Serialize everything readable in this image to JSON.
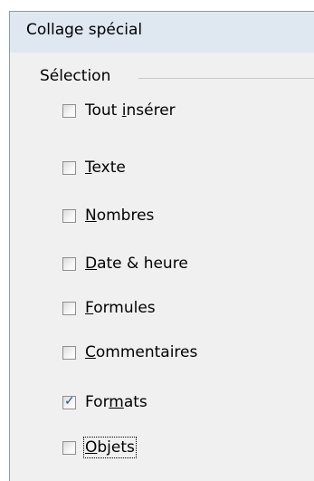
{
  "dialog": {
    "title": "Collage spécial"
  },
  "selection": {
    "label": "Sélection",
    "options": [
      {
        "pre": "Tout ",
        "ul": "i",
        "post": "nsérer",
        "checked": false
      },
      {
        "pre": "",
        "ul": "T",
        "post": "exte",
        "checked": false
      },
      {
        "pre": "",
        "ul": "N",
        "post": "ombres",
        "checked": false
      },
      {
        "pre": "",
        "ul": "D",
        "post": "ate & heure",
        "checked": false
      },
      {
        "pre": "",
        "ul": "F",
        "post": "ormules",
        "checked": false
      },
      {
        "pre": "",
        "ul": "C",
        "post": "ommentaires",
        "checked": false
      },
      {
        "pre": "For",
        "ul": "m",
        "post": "ats",
        "checked": true
      },
      {
        "pre": "",
        "ul": "O",
        "post": "bjets",
        "checked": false
      }
    ]
  },
  "check_mark": "✓",
  "colors": {
    "title_bg": "#dfe8f1",
    "panel_bg": "#f0f0f0",
    "check_color": "#1d4f9c"
  }
}
